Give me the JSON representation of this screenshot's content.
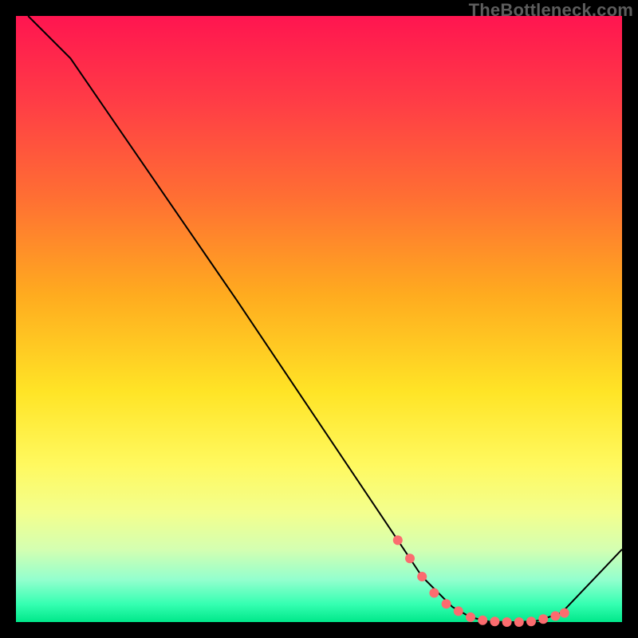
{
  "watermark": "TheBottleneck.com",
  "colors": {
    "page_bg": "#000000",
    "curve": "#000000",
    "marker": "#fb6c6f",
    "gradient_top": "#ff1550",
    "gradient_bottom": "#00e88a"
  },
  "chart_data": {
    "type": "line",
    "title": "",
    "xlabel": "",
    "ylabel": "",
    "xlim": [
      0,
      100
    ],
    "ylim": [
      0,
      100
    ],
    "grid": false,
    "legend": false,
    "x": [
      2,
      9,
      36.5,
      63,
      67,
      72,
      75,
      78,
      81,
      83,
      86,
      90,
      100
    ],
    "y": [
      100,
      93,
      53,
      13.5,
      7.5,
      2.5,
      0.8,
      0.1,
      0,
      0,
      0.2,
      1.5,
      12
    ],
    "flat_region_x": [
      75,
      90
    ],
    "markers_x": [
      63,
      65,
      67,
      69,
      71,
      73,
      75,
      77,
      79,
      81,
      83,
      85,
      87,
      89,
      90.5
    ],
    "markers_y": [
      13.5,
      10.5,
      7.5,
      4.8,
      3.0,
      1.8,
      0.8,
      0.3,
      0.1,
      0.0,
      0.0,
      0.1,
      0.5,
      1.0,
      1.5
    ],
    "marker_style": "circle",
    "marker_radius_px": 6
  }
}
